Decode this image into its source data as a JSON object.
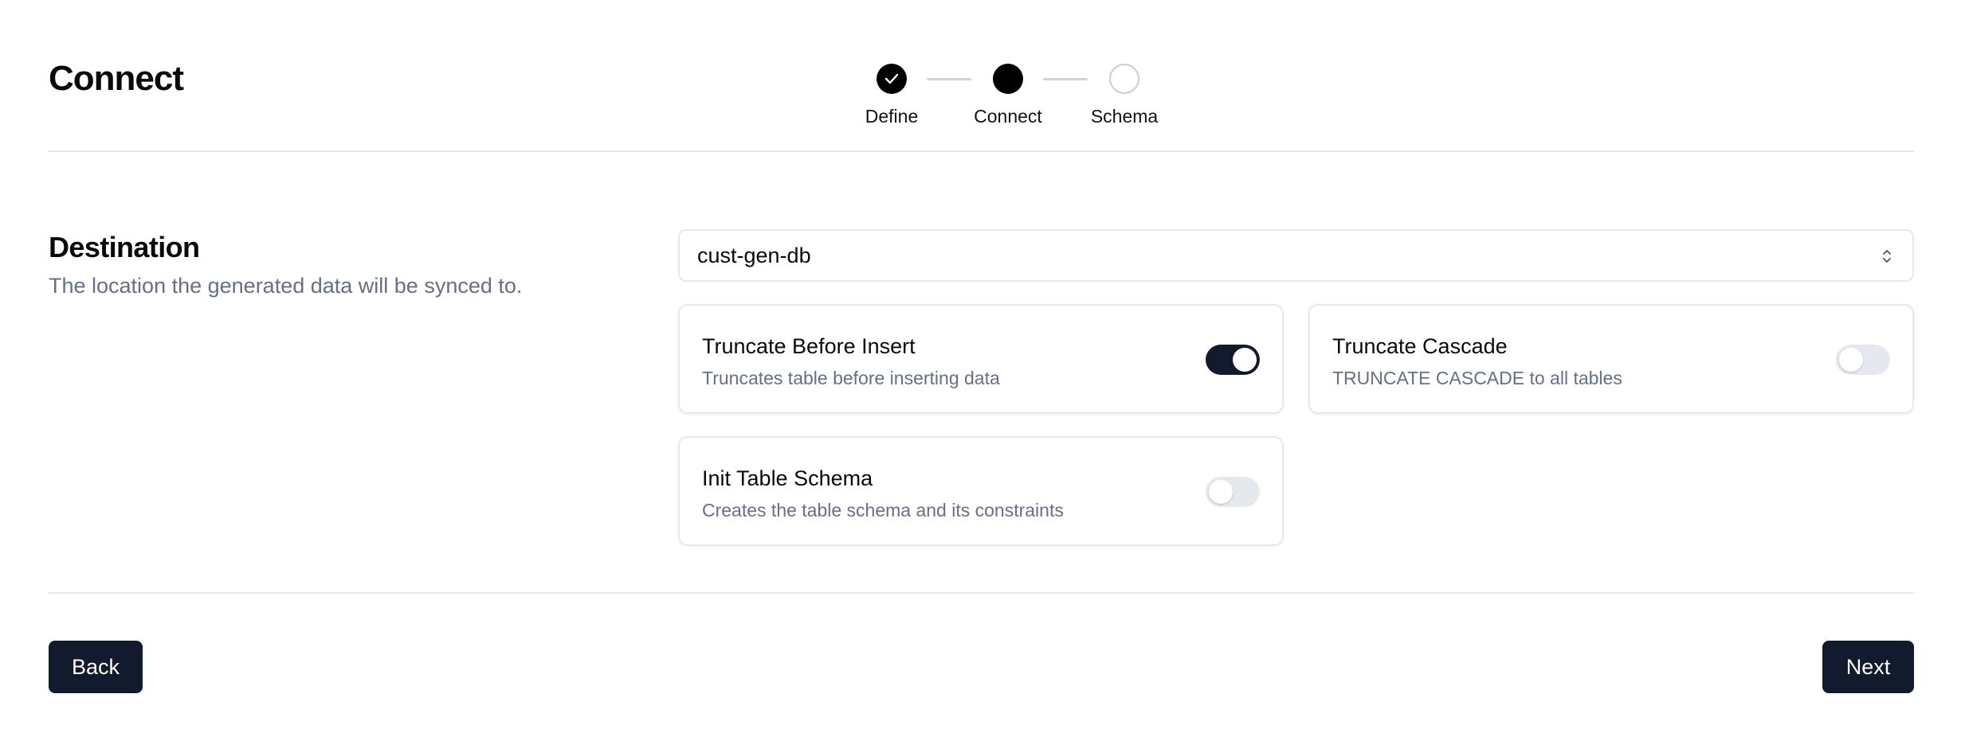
{
  "header": {
    "title": "Connect"
  },
  "stepper": {
    "steps": [
      {
        "label": "Define",
        "status": "complete"
      },
      {
        "label": "Connect",
        "status": "current"
      },
      {
        "label": "Schema",
        "status": "pending"
      }
    ]
  },
  "destination": {
    "title": "Destination",
    "description": "The location the generated data will be synced to.",
    "select": {
      "value": "cust-gen-db",
      "icon": "chevron-up-down-icon"
    },
    "options": [
      {
        "title": "Truncate Before Insert",
        "description": "Truncates table before inserting data",
        "enabled": true
      },
      {
        "title": "Truncate Cascade",
        "description": "TRUNCATE CASCADE to all tables",
        "enabled": false
      },
      {
        "title": "Init Table Schema",
        "description": "Creates the table schema and its constraints",
        "enabled": false
      }
    ]
  },
  "footer": {
    "back_label": "Back",
    "next_label": "Next"
  },
  "colors": {
    "primary_button": "#121a2d",
    "toggle_on": "#141a2e",
    "toggle_off": "#e5e8ed",
    "muted_text": "#667085",
    "border": "#e6e8ec"
  }
}
